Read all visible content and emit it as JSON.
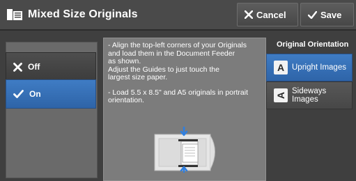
{
  "header": {
    "title": "Mixed Size Originals",
    "cancel_label": "Cancel",
    "save_label": "Save"
  },
  "options": {
    "off_label": "Off",
    "on_label": "On",
    "selected": "On"
  },
  "instructions": {
    "paragraph1": "- Align the top-left corners of your Originals\nand load them in the Document Feeder\nas shown.\nAdjust the Guides to just touch the\nlargest size paper.",
    "paragraph2": "- Load 5.5 x 8.5\" and A5 originals in portrait\norientation."
  },
  "orientation": {
    "heading": "Original Orientation",
    "upright_glyph": "A",
    "upright_label": "Upright Images",
    "sideways_glyph": "A",
    "sideways_label": "Sideways\nImages",
    "selected": "Upright Images"
  },
  "colors": {
    "selected_blue": "#3570b8",
    "guide_arrow_blue": "#2f7fe0"
  }
}
